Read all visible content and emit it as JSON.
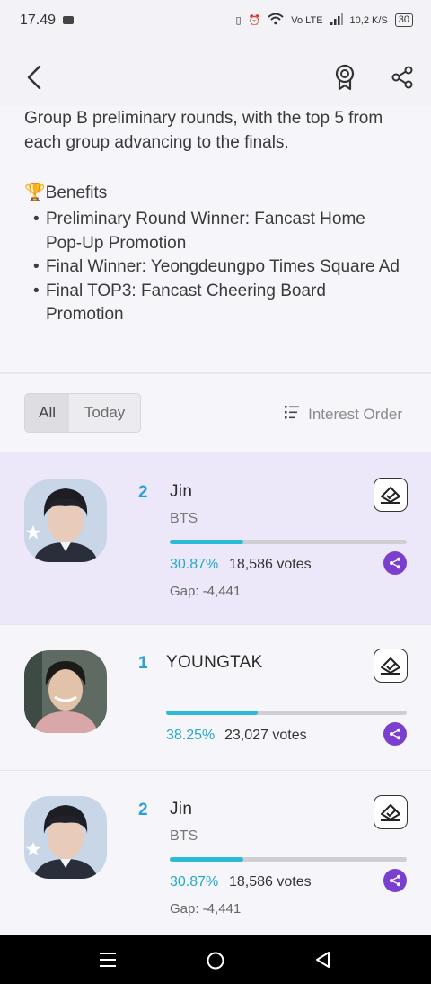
{
  "status": {
    "time": "17.49",
    "net_label": "Vo LTE",
    "speed": "10,2",
    "speed_unit": "K/S",
    "battery": "30"
  },
  "description": {
    "text": "Group B preliminary rounds, with the top 5 from each group advancing to the finals.",
    "benefits_title": "🏆Benefits",
    "benefits": [
      "Preliminary Round Winner: Fancast Home Pop-Up Promotion",
      "Final Winner: Yeongdeungpo Times Square Ad",
      "Final TOP3: Fancast Cheering Board Promotion"
    ]
  },
  "filters": {
    "all_label": "All",
    "today_label": "Today",
    "sort_label": "Interest Order"
  },
  "cards": [
    {
      "rank": "2",
      "name": "Jin",
      "group": "BTS",
      "percent": "30.87%",
      "votes": "18,586 votes",
      "gap": "Gap: -4,441",
      "fill": 0.31
    },
    {
      "rank": "1",
      "name": "YOUNGTAK",
      "group": "",
      "percent": "38.25%",
      "votes": "23,027 votes",
      "gap": "",
      "fill": 0.38
    },
    {
      "rank": "2",
      "name": "Jin",
      "group": "BTS",
      "percent": "30.87%",
      "votes": "18,586 votes",
      "gap": "Gap: -4,441",
      "fill": 0.31
    }
  ],
  "icons": {
    "back": "back-arrow-icon",
    "badge": "award-badge-icon",
    "share": "share-icon",
    "vote": "vote-ballot-icon"
  },
  "colors": {
    "accent": "#2bbbd9",
    "rank": "#2a9fd8",
    "share": "#7b3fd0",
    "highlight": "#ece8fa"
  }
}
